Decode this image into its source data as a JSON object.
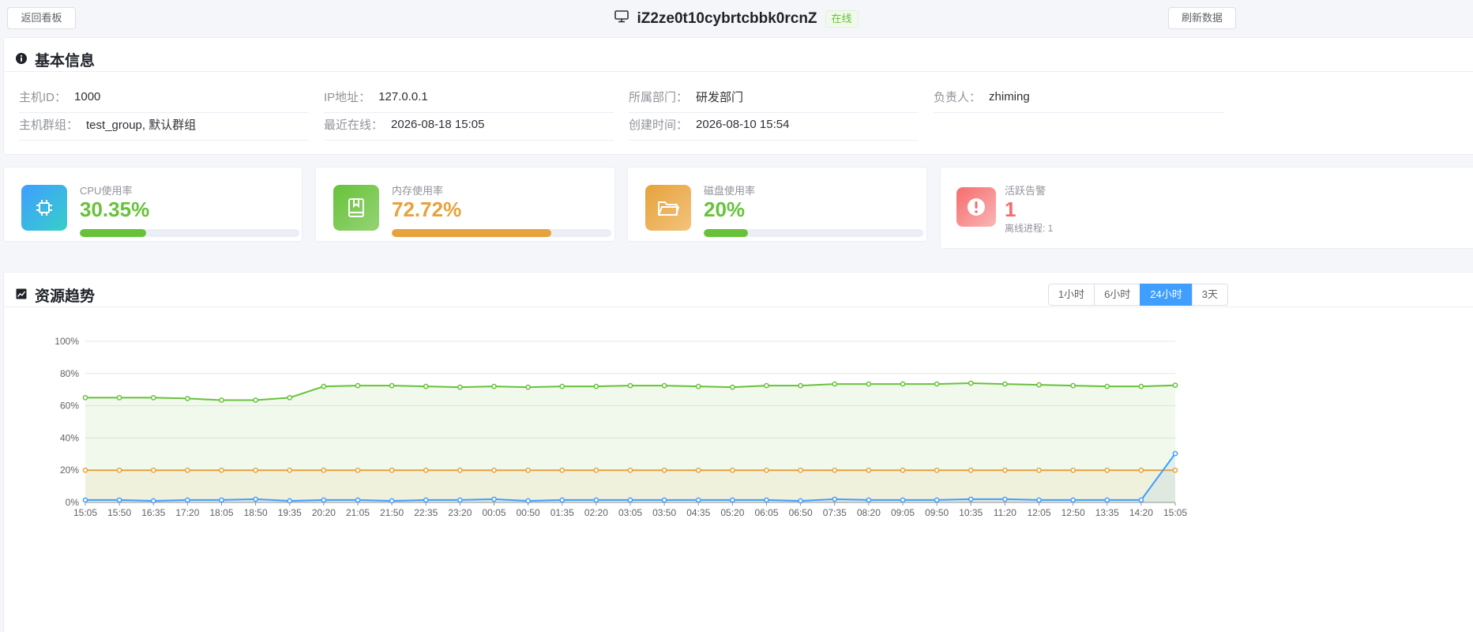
{
  "header": {
    "back_label": "返回看板",
    "host_name": "iZ2ze0t10cybrtcbbk0rcnZ",
    "status": "在线",
    "refresh_label": "刷新数据"
  },
  "basic_info": {
    "title": "基本信息",
    "fields": [
      {
        "label": "主机ID：",
        "value": "1000"
      },
      {
        "label": "IP地址：",
        "value": "127.0.0.1"
      },
      {
        "label": "所属部门：",
        "value": "研发部门"
      },
      {
        "label": "负责人：",
        "value": "zhiming"
      },
      {
        "label": "主机群组：",
        "value": "test_group, 默认群组"
      },
      {
        "label": "最近在线：",
        "value": "2026-08-18 15:05"
      },
      {
        "label": "创建时间：",
        "value": "2026-08-10 15:54"
      }
    ]
  },
  "metrics": [
    {
      "label": "CPU使用率",
      "value": "30.35%",
      "percent": 30.35,
      "color": "#67c23a",
      "icon": "chip-icon"
    },
    {
      "label": "内存使用率",
      "value": "72.72%",
      "percent": 72.72,
      "color": "#e6a23c",
      "icon": "book-icon"
    },
    {
      "label": "磁盘使用率",
      "value": "20%",
      "percent": 20,
      "color": "#67c23a",
      "icon": "folder-icon"
    }
  ],
  "alerts": {
    "label": "活跃告警",
    "value": "1",
    "sub": "离线进程: 1",
    "color": "#f56c6c"
  },
  "trend": {
    "title": "资源趋势",
    "ranges": [
      "1小时",
      "6小时",
      "24小时",
      "3天"
    ],
    "active_range": "24小时"
  },
  "chart_data": {
    "type": "line",
    "x": [
      "15:05",
      "15:50",
      "16:35",
      "17:20",
      "18:05",
      "18:50",
      "19:35",
      "20:20",
      "21:05",
      "21:50",
      "22:35",
      "23:20",
      "00:05",
      "00:50",
      "01:35",
      "02:20",
      "03:05",
      "03:50",
      "04:35",
      "05:20",
      "06:05",
      "06:50",
      "07:35",
      "08:20",
      "09:05",
      "09:50",
      "10:35",
      "11:20",
      "12:05",
      "12:50",
      "13:35",
      "14:20",
      "15:05"
    ],
    "ylim": [
      0,
      100
    ],
    "yticks": [
      "0%",
      "20%",
      "40%",
      "60%",
      "80%",
      "100%"
    ],
    "grid": true,
    "series": [
      {
        "values": [
          65,
          65,
          65,
          64.5,
          63.5,
          63.5,
          65,
          72,
          72.5,
          72.5,
          72,
          71.5,
          72,
          71.5,
          72,
          72,
          72.5,
          72.5,
          72,
          71.5,
          72.5,
          72.5,
          73.5,
          73.5,
          73.5,
          73.5,
          74,
          73.5,
          73,
          72.5,
          72,
          72,
          72.72
        ],
        "color": "#67c23a"
      },
      {
        "values": [
          20,
          20,
          20,
          20,
          20,
          20,
          20,
          20,
          20,
          20,
          20,
          20,
          20,
          20,
          20,
          20,
          20,
          20,
          20,
          20,
          20,
          20,
          20,
          20,
          20,
          20,
          20,
          20,
          20,
          20,
          20,
          20,
          20
        ],
        "color": "#e6a23c"
      },
      {
        "values": [
          1.5,
          1.5,
          1,
          1.5,
          1.5,
          2,
          1,
          1.5,
          1.5,
          1,
          1.5,
          1.5,
          2,
          1,
          1.5,
          1.5,
          1.5,
          1.5,
          1.5,
          1.5,
          1.5,
          1,
          2,
          1.5,
          1.5,
          1.5,
          2,
          2,
          1.5,
          1.5,
          1.5,
          1.5,
          30.35
        ],
        "color": "#409eff"
      }
    ],
    "annotations": []
  }
}
